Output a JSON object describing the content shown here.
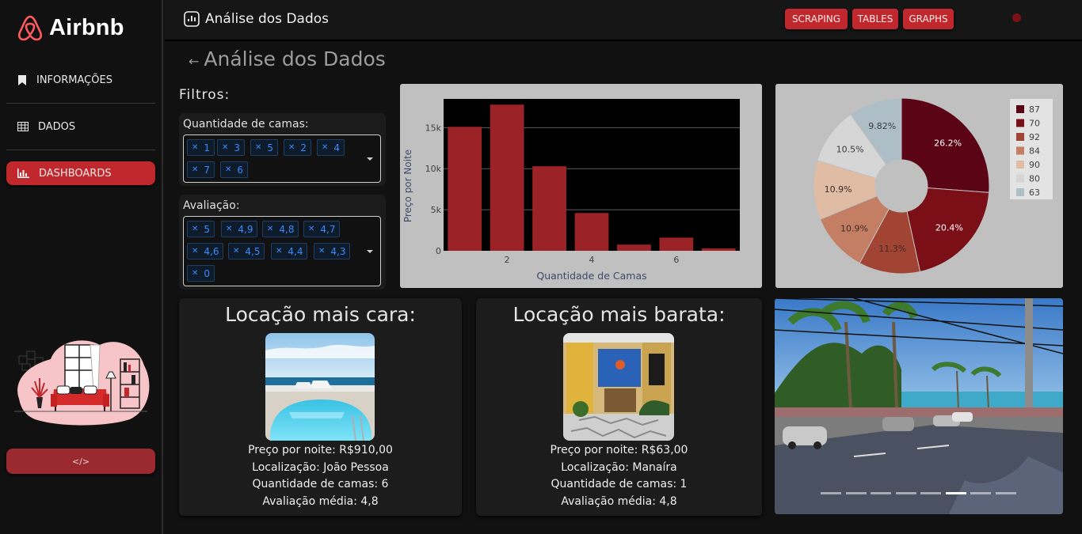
{
  "brand": {
    "name": "Airbnb",
    "logo_color": "#ff5a5f"
  },
  "sidebar": {
    "items": [
      {
        "label": "INFORMAÇÕES",
        "icon": "bookmark-icon"
      },
      {
        "label": "DADOS",
        "icon": "table-icon"
      },
      {
        "label": "DASHBOARDS",
        "icon": "bar-chart-icon"
      }
    ],
    "code_button": {
      "label": "</>"
    }
  },
  "topbar": {
    "title": "Análise dos Dados",
    "buttons": [
      {
        "label": "SCRAPING"
      },
      {
        "label": "TABLES"
      },
      {
        "label": "GRAPHS"
      }
    ]
  },
  "page": {
    "title": "Análise dos Dados",
    "back_arrow": "←"
  },
  "filters": {
    "title": "Filtros:",
    "beds": {
      "label": "Quantidade de camas:",
      "chips": [
        "1",
        "3",
        "5",
        "2",
        "4",
        "7",
        "6"
      ]
    },
    "rating": {
      "label": "Avaliação:",
      "chips": [
        "5",
        "4,9",
        "4,8",
        "4,7",
        "4,6",
        "4,5",
        "4,4",
        "4,3",
        "0"
      ]
    }
  },
  "chart_data": [
    {
      "type": "bar",
      "x": [
        1,
        2,
        3,
        4,
        5,
        6,
        7
      ],
      "values": [
        15100,
        17800,
        10300,
        4600,
        750,
        1600,
        300
      ],
      "xlabel": "Quantidade de Camas",
      "ylabel": "Preço por Noite",
      "xticks": [
        "2",
        "4",
        "6"
      ],
      "yticks": [
        "0",
        "5k",
        "10k",
        "15k"
      ],
      "ylim": [
        0,
        18500
      ],
      "bar_color": "#9b2226",
      "plot_background": "#000000"
    },
    {
      "type": "pie",
      "hole": true,
      "categories": [
        "87",
        "70",
        "92",
        "84",
        "90",
        "80",
        "63"
      ],
      "values": [
        26.2,
        20.4,
        11.3,
        10.9,
        10.9,
        10.5,
        9.82
      ],
      "slice_labels": [
        "26.2%",
        "20.4%",
        "11.3%",
        "10.9%",
        "10.9%",
        "10.5%",
        "9.82%"
      ],
      "colors": [
        "#5a0416",
        "#7a0f18",
        "#a24433",
        "#c37e63",
        "#e0bca5",
        "#d6d6d6",
        "#aebec7"
      ],
      "legend": "top-right"
    }
  ],
  "cards": {
    "expensive": {
      "title": "Locação mais cara:",
      "price": "Preço por noite: R$910,00",
      "location": "Localização: João Pessoa",
      "beds": "Quantidade de camas: 6",
      "rating": "Avaliação média: 4,8"
    },
    "cheap": {
      "title": "Locação mais barata:",
      "price": "Preço por noite: R$63,00",
      "location": "Localização: Manaíra",
      "beds": "Quantidade de camas: 1",
      "rating": "Avaliação média: 4,8"
    }
  },
  "carousel": {
    "slide_count": 8,
    "active_index": 5
  }
}
